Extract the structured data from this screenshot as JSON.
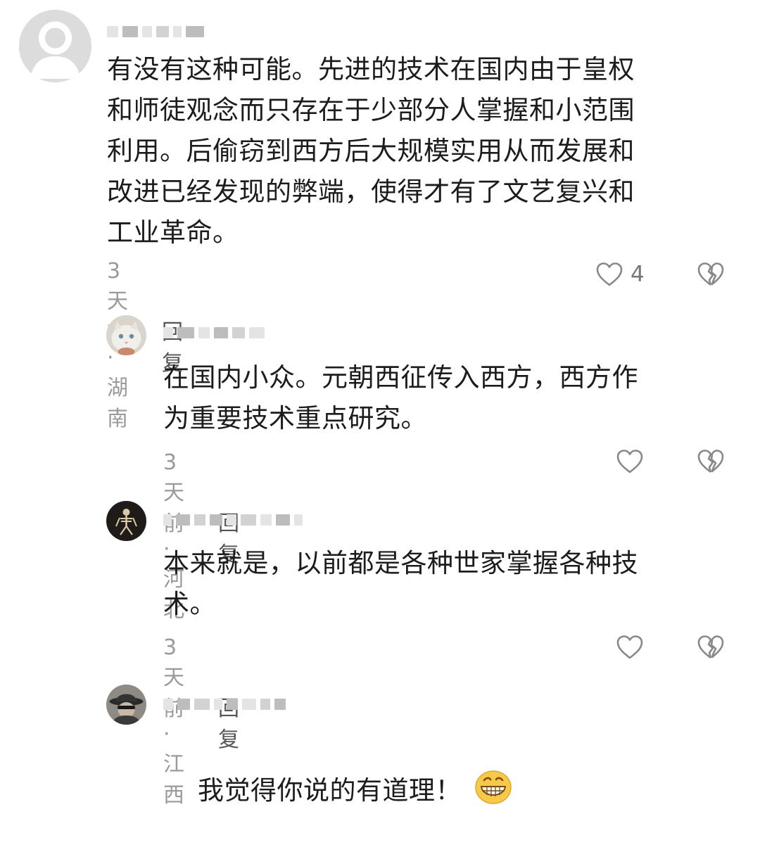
{
  "comments": [
    {
      "text": "有没有这种可能。先进的技术在国内由于皇权\n和师徒观念而只存在于少部分人掌握和小范围\n利用。后偷窃到西方后大规模实用从而发展和\n改进已经发现的弊端，使得才有了文艺复兴和\n工业革命。",
      "time_location": "3天前 · 湖南",
      "reply_label": "回复",
      "like_count": "4",
      "avatar_icon": "default-avatar-icon"
    },
    {
      "text": "在国内小众。元朝西征传入西方，西方作\n为重要技术重点研究。",
      "time_location": "3天前 · 河北",
      "reply_label": "回复",
      "avatar_icon": "cat-avatar"
    },
    {
      "text": "本来就是，以前都是各种世家掌握各种技\n术。",
      "time_location": "3天前 · 江西",
      "reply_label": "回复",
      "avatar_icon": "skeleton-avatar"
    },
    {
      "text": "我觉得你说的有道理！",
      "emoji": "grinning-face-emoji",
      "avatar_icon": "hat-avatar"
    }
  ],
  "colors": {
    "text": "#1c1c1c",
    "meta": "#9a9a9a",
    "reply": "#555555"
  }
}
